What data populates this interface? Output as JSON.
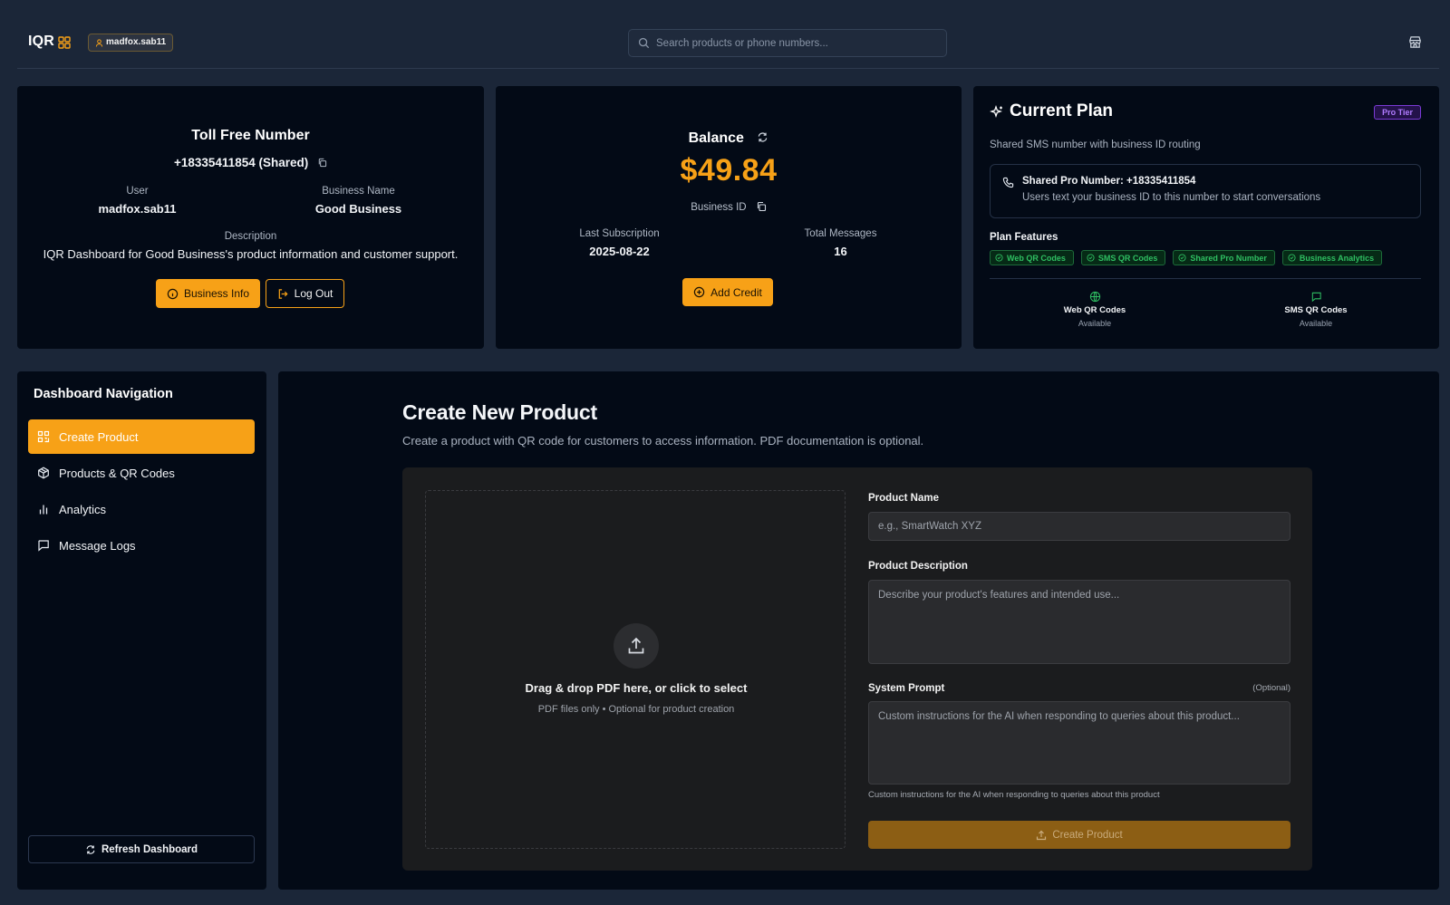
{
  "header": {
    "logo": "IQR",
    "username": "madfox.sab11",
    "search_placeholder": "Search products or phone numbers..."
  },
  "toll": {
    "title": "Toll Free Number",
    "number": "+18335411854 (Shared)",
    "user_label": "User",
    "user_value": "madfox.sab11",
    "business_label": "Business Name",
    "business_value": "Good Business",
    "description_label": "Description",
    "description_value": "IQR Dashboard for Good Business's product information and customer support.",
    "business_info_button": "Business Info",
    "logout_button": "Log Out"
  },
  "balance": {
    "title": "Balance",
    "amount": "$49.84",
    "business_id_label": "Business ID",
    "last_sub_label": "Last Subscription",
    "last_sub_value": "2025-08-22",
    "total_messages_label": "Total Messages",
    "total_messages_value": "16",
    "add_credit_button": "Add Credit"
  },
  "plan": {
    "title": "Current Plan",
    "tier": "Pro Tier",
    "subtitle": "Shared SMS number with business ID routing",
    "number_title": "Shared Pro Number: +18335411854",
    "number_desc": "Users text your business ID to this number to start conversations",
    "features_title": "Plan Features",
    "features": [
      "Web QR Codes",
      "SMS QR Codes",
      "Shared Pro Number",
      "Business Analytics"
    ],
    "stats": [
      {
        "name": "Web QR Codes",
        "status": "Available"
      },
      {
        "name": "SMS QR Codes",
        "status": "Available"
      }
    ]
  },
  "nav": {
    "title": "Dashboard Navigation",
    "items": [
      {
        "label": "Create Product",
        "icon": "qr-code-icon"
      },
      {
        "label": "Products & QR Codes",
        "icon": "package-icon"
      },
      {
        "label": "Analytics",
        "icon": "bar-chart-icon"
      },
      {
        "label": "Message Logs",
        "icon": "message-square-icon"
      }
    ],
    "refresh_button": "Refresh Dashboard"
  },
  "main": {
    "title": "Create New Product",
    "subtitle": "Create a product with QR code for customers to access information. PDF documentation is optional.",
    "dropzone_title": "Drag & drop PDF here, or click to select",
    "dropzone_sub": "PDF files only • Optional for product creation",
    "product_name_label": "Product Name",
    "product_name_placeholder": "e.g., SmartWatch XYZ",
    "product_desc_label": "Product Description",
    "product_desc_placeholder": "Describe your product's features and intended use...",
    "system_prompt_label": "System Prompt",
    "system_prompt_optional": "(Optional)",
    "system_prompt_placeholder": "Custom instructions for the AI when responding to queries about this product...",
    "system_prompt_help": "Custom instructions for the AI when responding to queries about this product",
    "create_button": "Create Product"
  },
  "colors": {
    "accent": "#f7a117",
    "background": "#1b2638",
    "panel": "#030a16",
    "success": "#2fbf62",
    "tier": "#b07bff"
  }
}
